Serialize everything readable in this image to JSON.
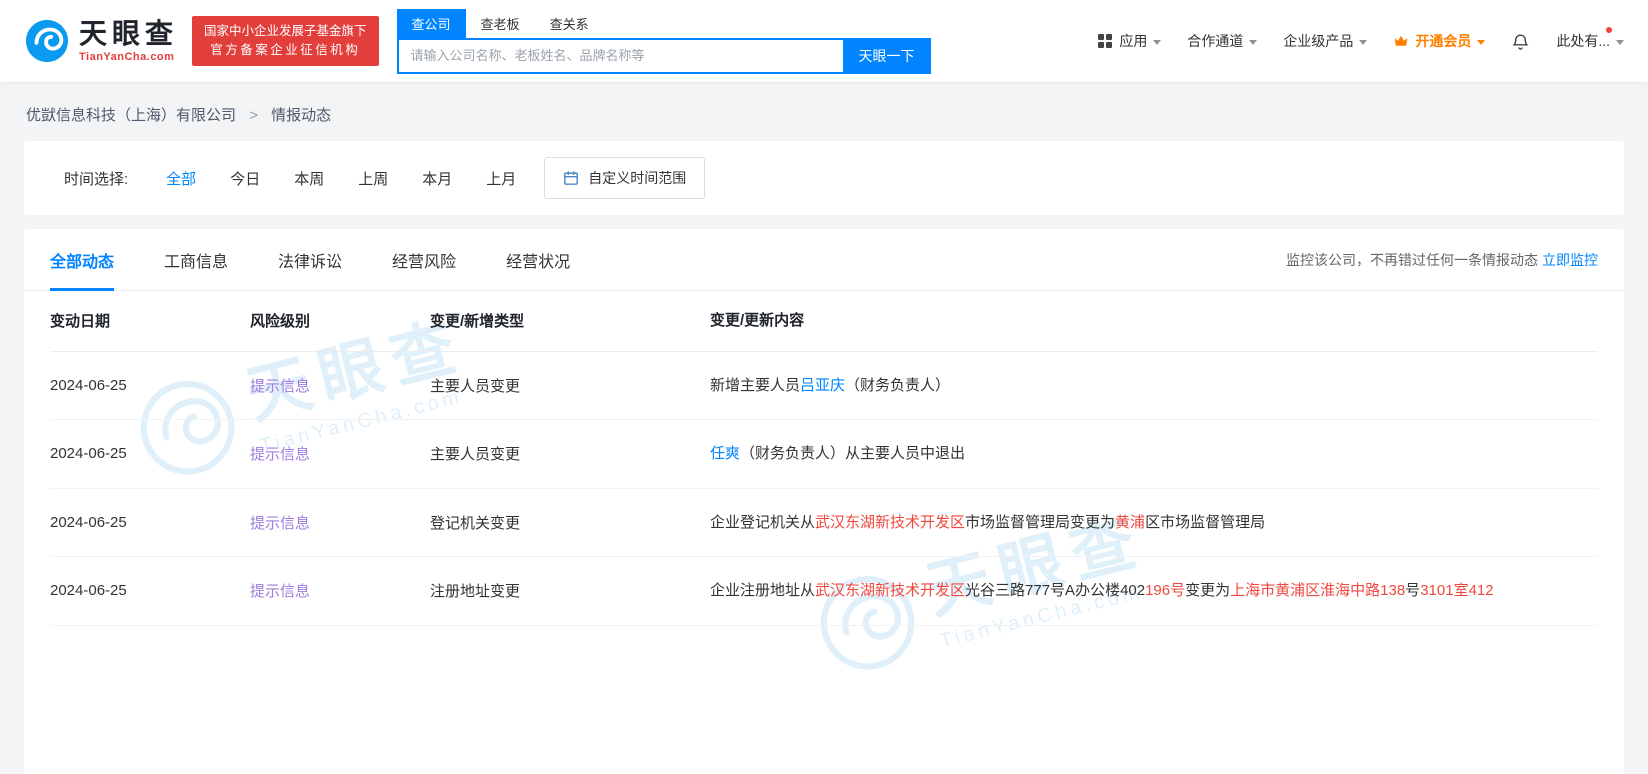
{
  "header": {
    "logo": {
      "brand": "天眼查",
      "domain": "TianYanCha.com"
    },
    "badge": {
      "line1": "国家中小企业发展子基金旗下",
      "line2": "官方备案企业征信机构"
    },
    "search": {
      "tabs": [
        {
          "label": "查公司",
          "active": true
        },
        {
          "label": "查老板",
          "active": false
        },
        {
          "label": "查关系",
          "active": false
        }
      ],
      "placeholder": "请输入公司名称、老板姓名、品牌名称等",
      "button": "天眼一下"
    },
    "nav": [
      {
        "label": "应用",
        "icon": "grid-icon"
      },
      {
        "label": "合作通道"
      },
      {
        "label": "企业级产品"
      },
      {
        "label": "开通会员",
        "icon": "crown-icon"
      },
      {
        "label": "此处有...",
        "badge_dot": true
      }
    ],
    "bell_icon": "bell-icon"
  },
  "breadcrumb": {
    "company": "优獃信息科技（上海）有限公司",
    "separator": ">",
    "current": "情报动态"
  },
  "time_filter": {
    "label": "时间选择:",
    "options": [
      "全部",
      "今日",
      "本周",
      "上周",
      "本月",
      "上月"
    ],
    "active_option": "全部",
    "custom_button": "自定义时间范围",
    "calendar_icon": "calendar-icon"
  },
  "tabs": [
    {
      "label": "全部动态",
      "active": true
    },
    {
      "label": "工商信息",
      "active": false
    },
    {
      "label": "法律诉讼",
      "active": false
    },
    {
      "label": "经营风险",
      "active": false
    },
    {
      "label": "经营状况",
      "active": false
    }
  ],
  "monitor": {
    "text": "监控该公司，不再错过任何一条情报动态",
    "link": "立即监控"
  },
  "table": {
    "headers": [
      "变动日期",
      "风险级别",
      "变更/新增类型",
      "变更/更新内容"
    ],
    "rows": [
      {
        "date": "2024-06-25",
        "risk": "提示信息",
        "type": "主要人员变更",
        "content": [
          {
            "text": "新增主要人员"
          },
          {
            "text": "吕亚庆",
            "color": "link"
          },
          {
            "text": "（财务负责人）"
          }
        ]
      },
      {
        "date": "2024-06-25",
        "risk": "提示信息",
        "type": "主要人员变更",
        "content": [
          {
            "text": "任爽",
            "color": "link"
          },
          {
            "text": "（财务负责人）从主要人员中退出"
          }
        ]
      },
      {
        "date": "2024-06-25",
        "risk": "提示信息",
        "type": "登记机关变更",
        "content": [
          {
            "text": "企业登记机关从"
          },
          {
            "text": "武汉东湖新技术开发区",
            "color": "red"
          },
          {
            "text": "市场监督管理局变更为"
          },
          {
            "text": "黄浦",
            "color": "red"
          },
          {
            "text": "区市场监督管理局"
          }
        ]
      },
      {
        "date": "2024-06-25",
        "risk": "提示信息",
        "type": "注册地址变更",
        "content": [
          {
            "text": "企业注册地址从"
          },
          {
            "text": "武汉东湖新技术开发区",
            "color": "red"
          },
          {
            "text": "光谷三路777号A办公楼402"
          },
          {
            "text": "196号",
            "color": "red"
          },
          {
            "text": "变更为"
          },
          {
            "text": "上海市黄浦区淮海中路138",
            "color": "red"
          },
          {
            "text": "号"
          },
          {
            "text": "3101",
            "color": "red"
          },
          {
            "text": "室412",
            "color": "red"
          }
        ]
      }
    ]
  },
  "watermark": {
    "text": "天眼查",
    "sub": "TianYanCha.com"
  },
  "colors": {
    "accent_blue": "#0084ff",
    "badge_red": "#e23e3b",
    "diff_red": "#f0483e",
    "risk_purple": "#9e7ce0",
    "vip_orange": "#ff8000"
  }
}
